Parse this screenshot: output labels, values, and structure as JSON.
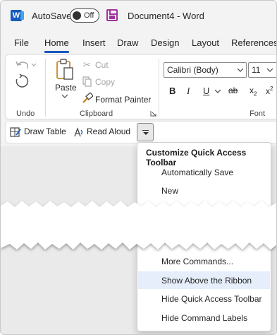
{
  "titlebar": {
    "autosave_label": "AutoSave",
    "autosave_state": "Off",
    "document_title": "Document4 - Word"
  },
  "tabs": [
    {
      "label": "File"
    },
    {
      "label": "Home"
    },
    {
      "label": "Insert"
    },
    {
      "label": "Draw"
    },
    {
      "label": "Design"
    },
    {
      "label": "Layout"
    },
    {
      "label": "References"
    }
  ],
  "ribbon": {
    "undo_group_label": "Undo",
    "paste_label": "Paste",
    "cut_label": "Cut",
    "copy_label": "Copy",
    "format_painter_label": "Format Painter",
    "clipboard_group_label": "Clipboard",
    "font_name": "Calibri (Body)",
    "font_size": "11",
    "font_group_label": "Font"
  },
  "qat": {
    "draw_table_label": "Draw Table",
    "read_aloud_label": "Read Aloud"
  },
  "menu": {
    "title": "Customize Quick Access Toolbar",
    "items": [
      {
        "label": "Automatically Save"
      },
      {
        "label": "New"
      },
      {
        "label": "More Commands..."
      },
      {
        "label": "Show Above the Ribbon"
      },
      {
        "label": "Hide Quick Access Toolbar"
      },
      {
        "label": "Hide Command Labels"
      }
    ]
  },
  "colors": {
    "accent": "#185abd",
    "highlight": "#e5eefa",
    "save_icon": "#a033a0"
  }
}
